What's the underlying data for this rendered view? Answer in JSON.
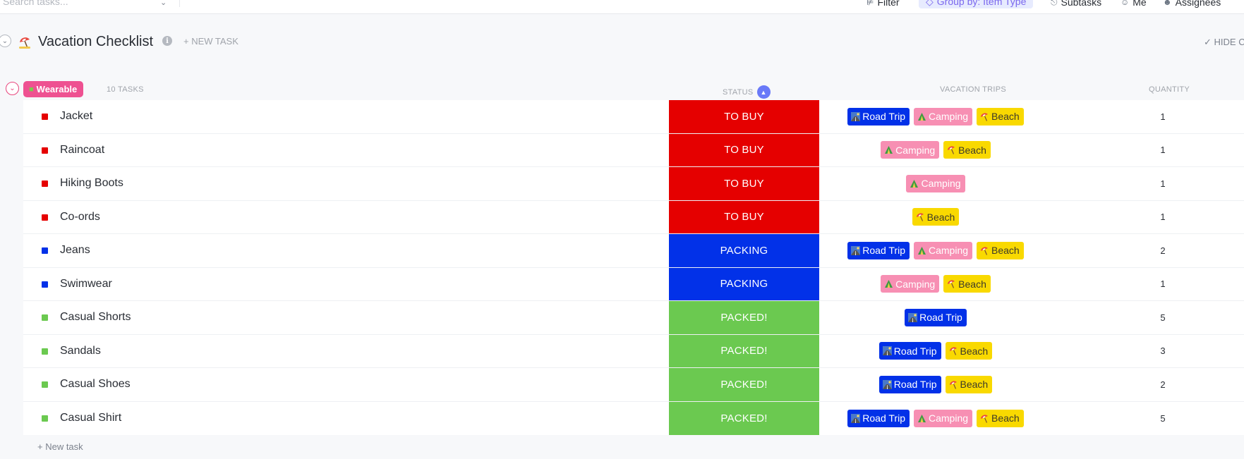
{
  "toolbar": {
    "search_placeholder": "Search tasks...",
    "filter_label": "Filter",
    "group_by_label": "Group by: Item Type",
    "subtasks_label": "Subtasks",
    "me_label": "Me",
    "assignees_label": "Assignees"
  },
  "list": {
    "title": "Vacation Checklist",
    "new_task_label": "+ NEW TASK",
    "hide_label": "HIDE C"
  },
  "group": {
    "name": "Wearable",
    "task_count": "10 TASKS",
    "color": "#ee5191"
  },
  "columns": {
    "status": "STATUS",
    "trips": "VACATION TRIPS",
    "quantity": "QUANTITY"
  },
  "status_colors": {
    "TO BUY": "#e50000",
    "PACKING": "#0231e8",
    "PACKED!": "#6bc950"
  },
  "tag_colors": {
    "Road Trip": {
      "bg": "#0231e8",
      "fg": "#ffffff",
      "icon": "road-icon"
    },
    "Camping": {
      "bg": "#f78fb3",
      "fg": "#ffffff",
      "icon": "tent-icon"
    },
    "Beach": {
      "bg": "#f9d900",
      "fg": "#3d3a2a",
      "icon": "beach-umbrella-icon"
    }
  },
  "tasks": [
    {
      "name": "Jacket",
      "status": "TO BUY",
      "trips": [
        "Road Trip",
        "Camping",
        "Beach"
      ],
      "quantity": "1"
    },
    {
      "name": "Raincoat",
      "status": "TO BUY",
      "trips": [
        "Camping",
        "Beach"
      ],
      "quantity": "1"
    },
    {
      "name": "Hiking Boots",
      "status": "TO BUY",
      "trips": [
        "Camping"
      ],
      "quantity": "1"
    },
    {
      "name": "Co-ords",
      "status": "TO BUY",
      "trips": [
        "Beach"
      ],
      "quantity": "1"
    },
    {
      "name": "Jeans",
      "status": "PACKING",
      "trips": [
        "Road Trip",
        "Camping",
        "Beach"
      ],
      "quantity": "2"
    },
    {
      "name": "Swimwear",
      "status": "PACKING",
      "trips": [
        "Camping",
        "Beach"
      ],
      "quantity": "1"
    },
    {
      "name": "Casual Shorts",
      "status": "PACKED!",
      "trips": [
        "Road Trip"
      ],
      "quantity": "5"
    },
    {
      "name": "Sandals",
      "status": "PACKED!",
      "trips": [
        "Road Trip",
        "Beach"
      ],
      "quantity": "3"
    },
    {
      "name": "Casual Shoes",
      "status": "PACKED!",
      "trips": [
        "Road Trip",
        "Beach"
      ],
      "quantity": "2"
    },
    {
      "name": "Casual Shirt",
      "status": "PACKED!",
      "trips": [
        "Road Trip",
        "Camping",
        "Beach"
      ],
      "quantity": "5"
    }
  ],
  "footer": {
    "add_task_label": "+ New task"
  }
}
